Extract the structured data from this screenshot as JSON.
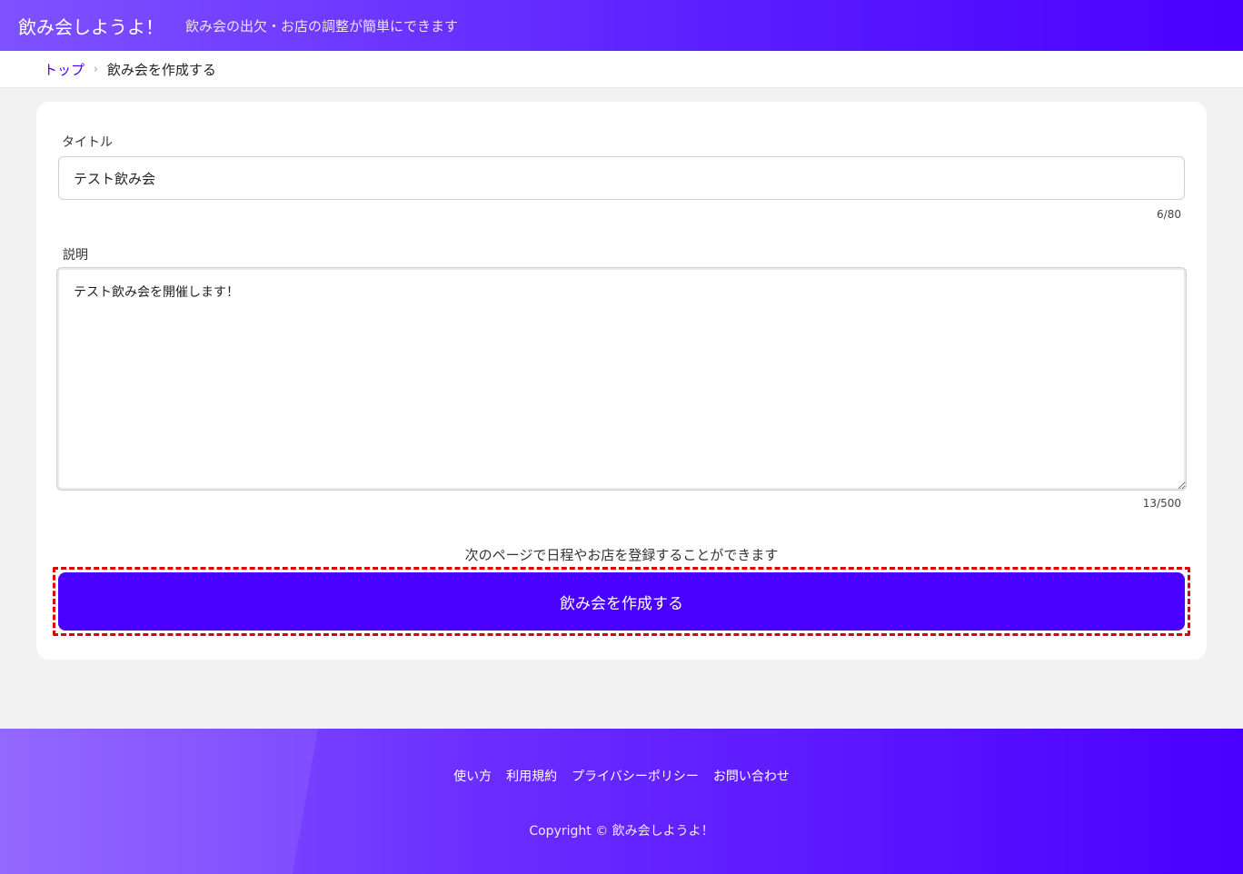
{
  "header": {
    "brand": "飲み会しようよ！",
    "tagline": "飲み会の出欠・お店の調整が簡単にできます"
  },
  "breadcrumb": {
    "home": "トップ",
    "separator": "›",
    "current": "飲み会を作成する"
  },
  "form": {
    "title_label": "タイトル",
    "title_value": "テスト飲み会",
    "title_counter": "6/80",
    "description_label": "説明",
    "description_value": "テスト飲み会を開催します！",
    "description_counter": "13/500",
    "hint": "次のページで日程やお店を登録することができます",
    "submit_label": "飲み会を作成する"
  },
  "footer": {
    "links": [
      "使い方",
      "利用規約",
      "プライバシーポリシー",
      "お問い合わせ"
    ],
    "copyright": "Copyright © 飲み会しようよ！"
  },
  "colors": {
    "accent": "#4a00ff",
    "highlight_border": "#e00000"
  }
}
